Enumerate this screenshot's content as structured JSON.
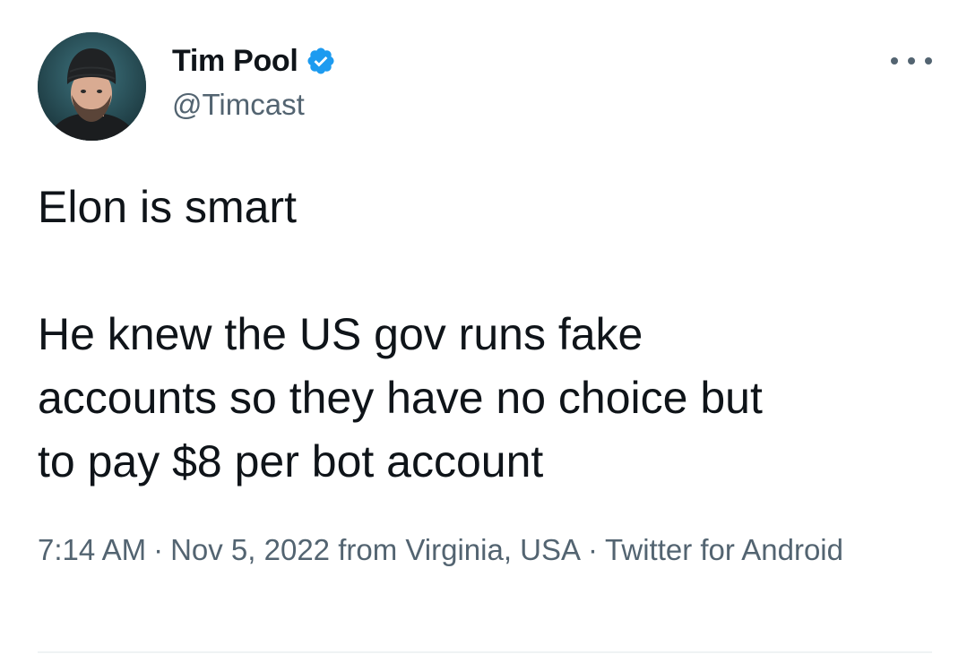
{
  "author": {
    "display_name": "Tim Pool",
    "handle": "@Timcast",
    "verified": true,
    "verified_icon": "verified-badge-icon"
  },
  "tweet": {
    "paragraph_1": "Elon is smart",
    "paragraph_2_line_1": "He knew the US gov runs fake",
    "paragraph_2_line_2": "accounts so they have no choice but",
    "paragraph_2_line_3": "to pay $8 per bot account"
  },
  "meta": {
    "time": "7:14 AM",
    "separator": "·",
    "date_location": "Nov 5, 2022 from Virginia, USA",
    "source": "Twitter for Android"
  },
  "icons": {
    "more": "more-options-icon"
  },
  "colors": {
    "text_primary": "#0f1419",
    "text_secondary": "#536471",
    "verified_blue": "#1d9bf0",
    "divider": "#eff3f4"
  }
}
